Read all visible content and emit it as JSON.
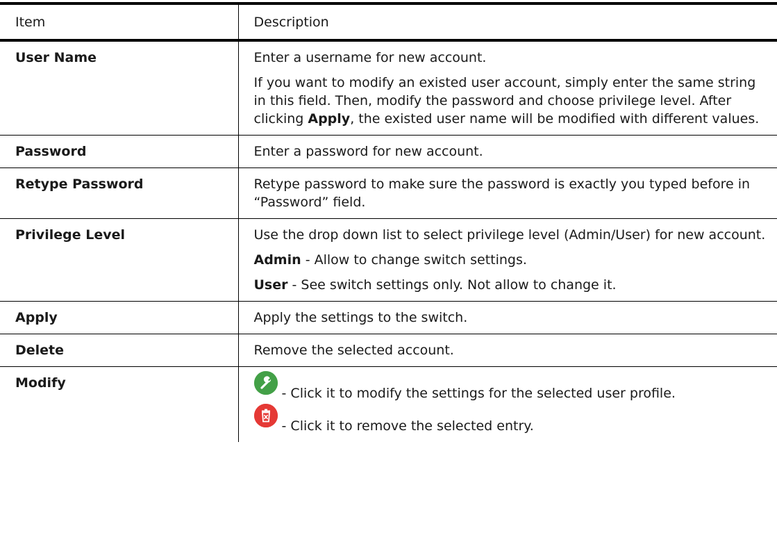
{
  "table": {
    "header": {
      "item": "Item",
      "description": "Description"
    },
    "rows": {
      "user_name": {
        "item": "User Name",
        "p1": "Enter a username for new account.",
        "p2_a": "If you want to modify an existed user account, simply enter the same string in this field. Then, modify the password and choose privilege level. After clicking ",
        "p2_bold": "Apply",
        "p2_b": ", the existed user name will be modified with different values."
      },
      "password": {
        "item": "Password",
        "p1": "Enter a password for new account."
      },
      "retype_password": {
        "item": "Retype Password",
        "p1": "Retype password to make sure the password is exactly you typed before in “Password” field."
      },
      "privilege_level": {
        "item": "Privilege Level",
        "p1": "Use the drop down list to select privilege level (Admin/User) for new account.",
        "p2_bold": "Admin",
        "p2_rest": " - Allow to change switch settings.",
        "p3_bold": "User",
        "p3_rest": " - See switch settings only. Not allow to change it."
      },
      "apply": {
        "item": "Apply",
        "p1": "Apply the settings to the switch."
      },
      "delete": {
        "item": "Delete",
        "p1": "Remove the selected account."
      },
      "modify": {
        "item": "Modify",
        "icon1": "wrench-icon",
        "icon1_color": "#4caf50",
        "p1": " - Click it to modify the settings for the selected user profile.",
        "icon2": "trash-icon",
        "icon2_color": "#e53935",
        "p2": " - Click it to remove the selected entry."
      }
    }
  }
}
